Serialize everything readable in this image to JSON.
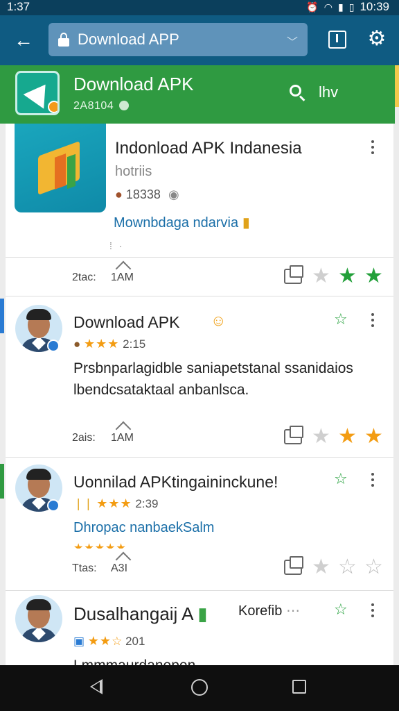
{
  "status_bar": {
    "time_left": "1:37",
    "time_right": "10:39",
    "icons": [
      "alarm-icon",
      "wifi-icon",
      "signal-icon",
      "battery-icon"
    ]
  },
  "app_bar": {
    "url_text": "Download APP"
  },
  "green_header": {
    "title": "Download APK",
    "subtitle": "2A8104",
    "search_label": "lhv"
  },
  "app_card": {
    "title": "Indonload APK Indanesia",
    "developer": "hotriis",
    "stats": "18338",
    "link": "Mownbdaga ndarvia",
    "action_time": "2tac:",
    "action_label": "1AM"
  },
  "reviews": [
    {
      "title": "Download APK",
      "rating_stars": "★★★",
      "meta_text": "2:15",
      "body": "Prsbnparlagidble saniapetstanal ssanidaios lbendcsataktaal anbanlsca.",
      "action_time": "2ais:",
      "action_label": "1AM"
    },
    {
      "title": "Uonnilad APKtingaininckune!",
      "rating_stars": "★★★",
      "meta_text": "2:39",
      "link": "Dhropac nanbaekSalm",
      "extra_stars": "★★★★★",
      "action_time": "Ttas:",
      "action_label": "A3I"
    },
    {
      "title": "Dusalhangaij A",
      "side_label": "Korefib",
      "rating_stars": "★★",
      "meta_text": "201",
      "body": "Lmmmaurdanepen"
    }
  ],
  "colors": {
    "status_bar": "#0b3f5c",
    "app_bar": "#0f5b82",
    "green_header": "#2f9a41",
    "link_blue": "#1b6fa8",
    "star_green": "#23a03a",
    "star_orange": "#f39c12"
  }
}
